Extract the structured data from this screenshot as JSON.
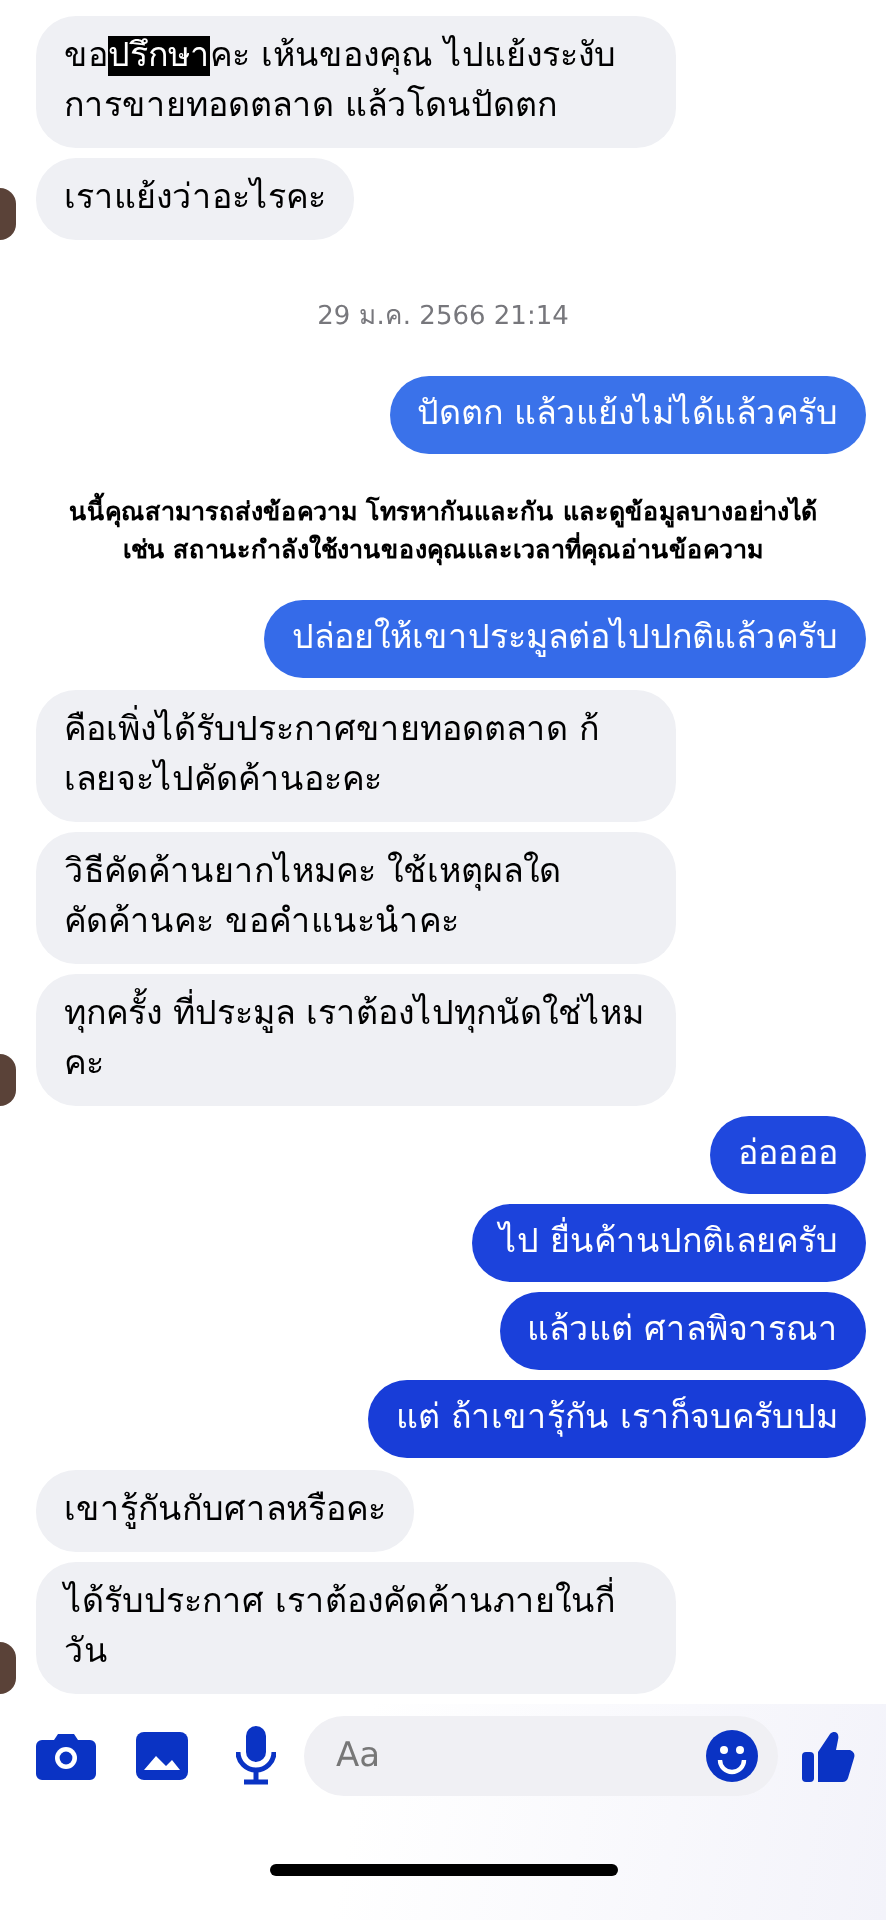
{
  "messages": [
    {
      "kind": "incoming",
      "avatar": false,
      "segments": [
        {
          "text": "ขอ",
          "highlighted": false
        },
        {
          "text": "ปรึกษา",
          "highlighted": true
        },
        {
          "text": "คะ  เห้นของคุณ ไปแย้งระงับการขายทอดตลาด แล้วโดนปัดตก",
          "highlighted": false
        }
      ]
    },
    {
      "kind": "incoming",
      "avatar": true,
      "text": "เราแย้งว่าอะไรคะ"
    },
    {
      "kind": "timestamp",
      "text": "29 ม.ค. 2566 21:14"
    },
    {
      "kind": "outgoing",
      "color": "#3a72ea",
      "text": "ปัดตก แล้วแย้งไม่ได้แล้วครับ"
    },
    {
      "kind": "notice",
      "lines": [
        "นนี้คุณสามารถส่งข้อความ โทรหากันและกัน และดูข้อมูลบางอย่างได้",
        "เช่น สถานะกำลังใช้งานของคุณและเวลาที่คุณอ่านข้อความ"
      ]
    },
    {
      "kind": "outgoing",
      "color": "#356be9",
      "text": "ปล่อยให้เขาประมูลต่อไปปกติแล้วครับ"
    },
    {
      "kind": "incoming",
      "avatar": false,
      "text": "คือเพิ่งได้รับประกาศขายทอดตลาด  ก้เลยจะไปคัดค้านอะคะ"
    },
    {
      "kind": "incoming",
      "avatar": false,
      "text": "วิธีคัดค้านยากไหมคะ ใช้เหตุผลใดคัดค้านคะ ขอคำแนะนำคะ"
    },
    {
      "kind": "incoming",
      "avatar": true,
      "text": "ทุกครั้ง ที่ประมูล เราต้องไปทุกนัดใช่ไหมคะ"
    },
    {
      "kind": "outgoing",
      "color": "#1f48de",
      "text": "อ่ออออ"
    },
    {
      "kind": "outgoing",
      "color": "#1c43dc",
      "text": "ไป ยื่นค้านปกติเลยครับ"
    },
    {
      "kind": "outgoing",
      "color": "#1a40da",
      "text": "แล้วแต่ ศาลพิจารณา"
    },
    {
      "kind": "outgoing",
      "color": "#183dd8",
      "text": "แต่  ถ้าเขารุ้กัน เราก็จบครับปม"
    },
    {
      "kind": "incoming",
      "avatar": false,
      "text": "เขารู้กันกับศาลหรือคะ"
    },
    {
      "kind": "incoming",
      "avatar": true,
      "text": "ได้รับประกาศ เราต้องคัดค้านภายในกี่วัน"
    }
  ],
  "composer": {
    "placeholder": "Aa"
  }
}
